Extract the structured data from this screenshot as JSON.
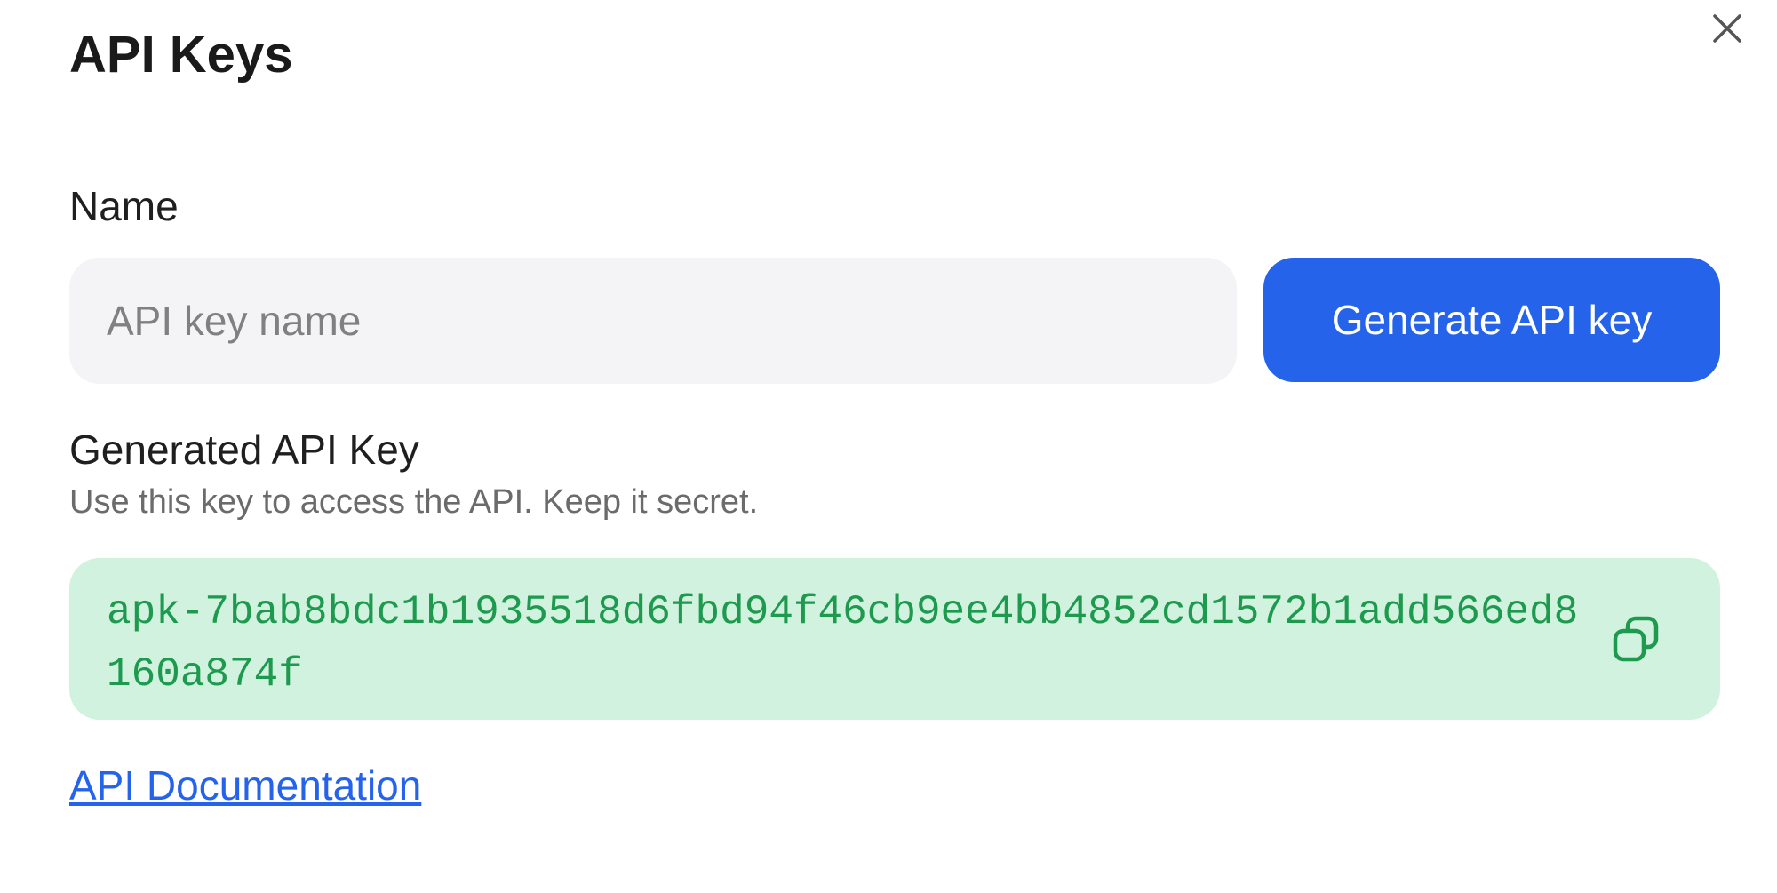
{
  "dialog": {
    "title": "API Keys",
    "close_icon": "close-icon"
  },
  "name_section": {
    "label": "Name",
    "input_value": "",
    "input_placeholder": "API key name",
    "generate_button_label": "Generate API key"
  },
  "generated_section": {
    "label": "Generated API Key",
    "helper_text": "Use this key to access the API. Keep it secret.",
    "api_key": "apk-7bab8bdc1b1935518d6fbd94f46cb9ee4bb4852cd1572b1add566ed8160a874f",
    "copy_icon": "copy-icon"
  },
  "links": {
    "documentation_label": "API Documentation"
  },
  "colors": {
    "accent": "#2563eb",
    "key_background": "#d1f2df",
    "key_text": "#1d9a4e",
    "input_background": "#f4f4f6"
  }
}
